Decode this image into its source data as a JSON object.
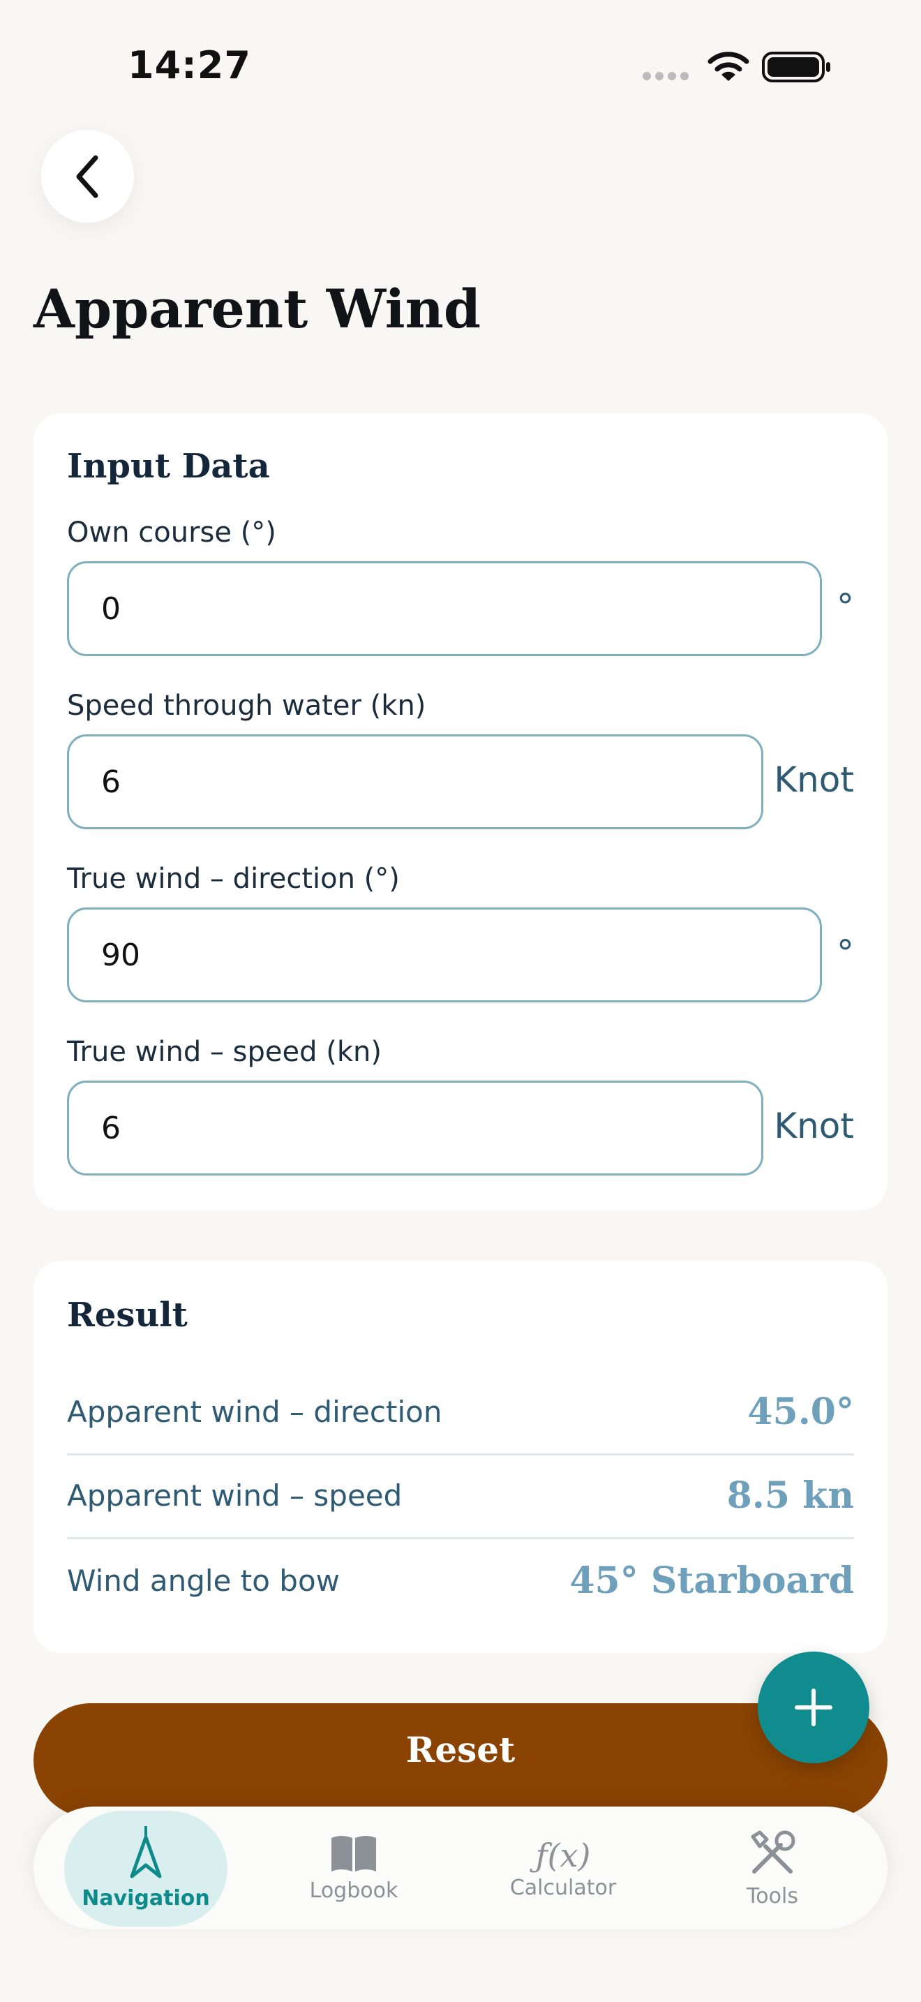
{
  "status_bar": {
    "time": "14:27"
  },
  "header": {
    "title": "Apparent Wind"
  },
  "input_card": {
    "title": "Input Data",
    "fields": [
      {
        "label": "Own course (°)",
        "value": "0",
        "unit": "°"
      },
      {
        "label": "Speed through water (kn)",
        "value": "6",
        "unit": "Knot"
      },
      {
        "label": "True wind – direction (°)",
        "value": "90",
        "unit": "°"
      },
      {
        "label": "True wind – speed (kn)",
        "value": "6",
        "unit": "Knot"
      }
    ]
  },
  "result_card": {
    "title": "Result",
    "rows": [
      {
        "label": "Apparent wind – direction",
        "value": "45.0°"
      },
      {
        "label": "Apparent wind – speed",
        "value": "8.5 kn"
      },
      {
        "label": "Wind angle to bow",
        "value": "45° Starboard"
      }
    ]
  },
  "reset_label": "Reset",
  "fab_icon": "plus-icon",
  "tab_bar": {
    "active": "Navigation",
    "items": [
      {
        "label": "Navigation",
        "icon": "navigation-arrow-icon"
      },
      {
        "label": "Logbook",
        "icon": "book-icon"
      },
      {
        "label": "Calculator",
        "icon": "function-icon"
      },
      {
        "label": "Tools",
        "icon": "tools-icon"
      }
    ]
  },
  "colors": {
    "accent": "#108c8f",
    "reset_button": "#8a4302",
    "result_value": "#6fa0bb",
    "input_border": "#7faebf"
  }
}
